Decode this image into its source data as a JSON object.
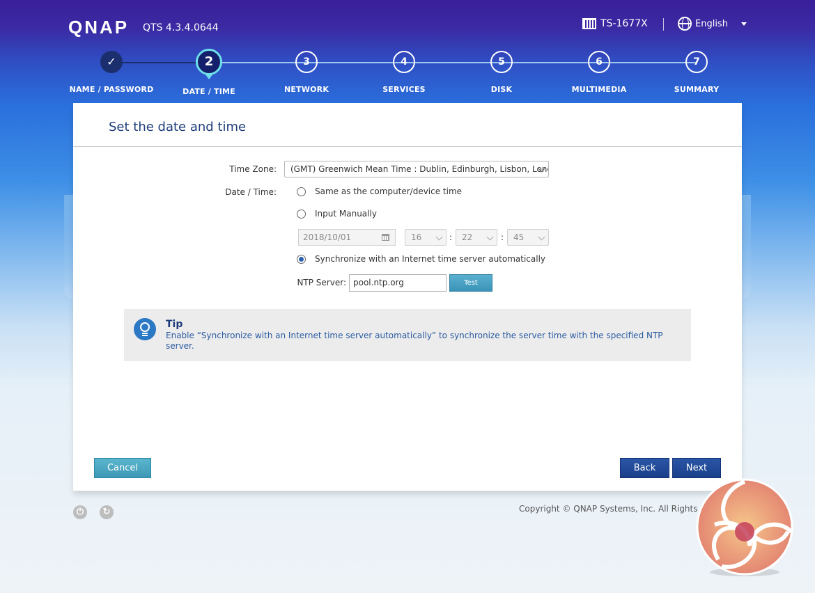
{
  "header": {
    "brand": "QNAP",
    "version": "QTS 4.3.4.0644",
    "model": "TS-1677X",
    "language": "English"
  },
  "steps": [
    {
      "number": "✓",
      "label": "NAME / PASSWORD",
      "state": "done"
    },
    {
      "number": "2",
      "label": "DATE / TIME",
      "state": "current"
    },
    {
      "number": "3",
      "label": "NETWORK",
      "state": "pending"
    },
    {
      "number": "4",
      "label": "SERVICES",
      "state": "pending"
    },
    {
      "number": "5",
      "label": "DISK",
      "state": "pending"
    },
    {
      "number": "6",
      "label": "MULTIMEDIA",
      "state": "pending"
    },
    {
      "number": "7",
      "label": "SUMMARY",
      "state": "pending"
    }
  ],
  "panel": {
    "title": "Set the date and time",
    "time_zone_label": "Time Zone:",
    "time_zone_value": "(GMT) Greenwich Mean Time : Dublin, Edinburgh, Lisbon, London",
    "date_time_label": "Date / Time:",
    "options": {
      "same_as_computer": "Same as the computer/device time",
      "input_manually": "Input Manually",
      "sync_internet": "Synchronize with an Internet time server automatically"
    },
    "selected_option": "sync_internet",
    "manual": {
      "date": "2018/10/01",
      "hour": "16",
      "minute": "22",
      "second": "45",
      "separator": ":"
    },
    "ntp_label": "NTP Server:",
    "ntp_value": "pool.ntp.org",
    "test_label": "Test"
  },
  "tip": {
    "title": "Tip",
    "text": "Enable “Synchronize with an Internet time server automatically” to synchronize the server time with the specified NTP server."
  },
  "buttons": {
    "cancel": "Cancel",
    "back": "Back",
    "next": "Next"
  },
  "footer": {
    "copyright": "Copyright © QNAP Systems, Inc. All Rights Reserved."
  },
  "colors": {
    "accent": "#1a3f8a",
    "current_step_ring": "#6ee0ea",
    "teal_button": "#3d98b6"
  }
}
